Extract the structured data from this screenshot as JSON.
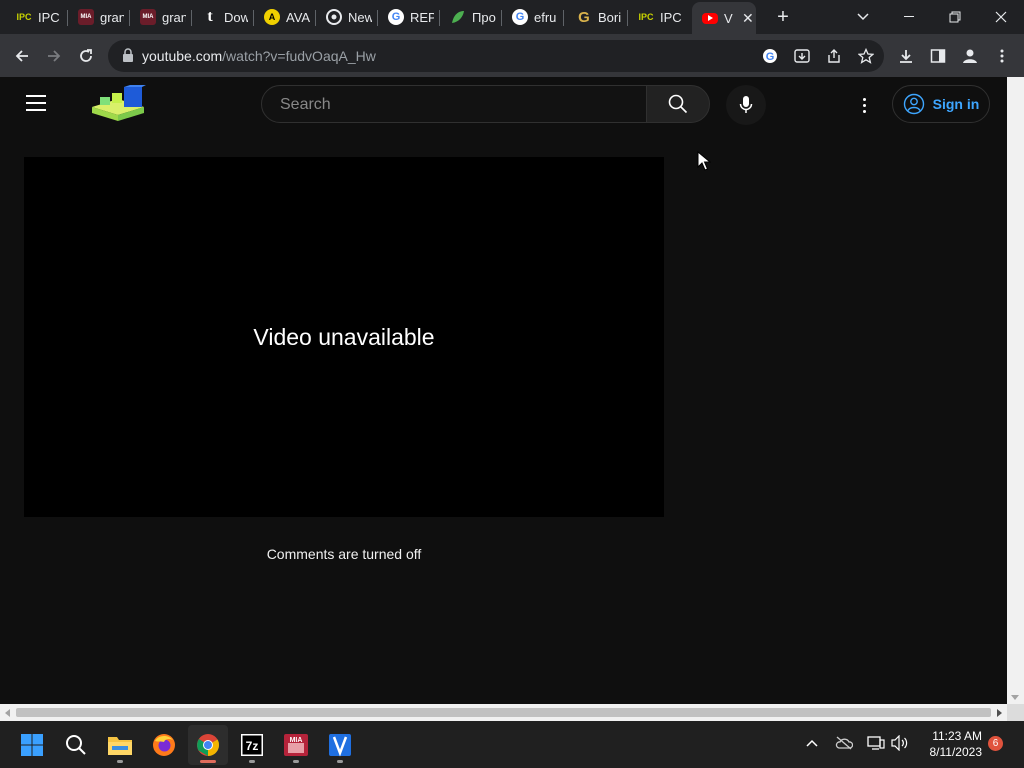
{
  "browser": {
    "tabs": [
      {
        "title": "IPC G",
        "icon": "ipc-games-icon"
      },
      {
        "title": "gran",
        "icon": "mia-icon"
      },
      {
        "title": "gran",
        "icon": "mia-icon"
      },
      {
        "title": "Dow",
        "icon": "tumblr-icon"
      },
      {
        "title": "AVA",
        "icon": "ava-icon"
      },
      {
        "title": "New",
        "icon": "chrome-icon"
      },
      {
        "title": "REP",
        "icon": "google-icon"
      },
      {
        "title": "Про",
        "icon": "leaf-icon"
      },
      {
        "title": "efru",
        "icon": "google-icon"
      },
      {
        "title": "Bori",
        "icon": "goodreads-icon"
      },
      {
        "title": "IPC",
        "icon": "ipc-games-icon"
      },
      {
        "title": "V",
        "icon": "youtube-icon",
        "active": true
      }
    ],
    "url_host": "youtube.com",
    "url_path": "/watch?v=fudvOaqA_Hw"
  },
  "youtube": {
    "search_placeholder": "Search",
    "signin_label": "Sign in",
    "player_message": "Video unavailable",
    "comments_message": "Comments are turned off",
    "accent_color": "#3ea6ff"
  },
  "taskbar": {
    "time": "11:23 AM",
    "date": "8/11/2023",
    "notification_count": "6"
  }
}
